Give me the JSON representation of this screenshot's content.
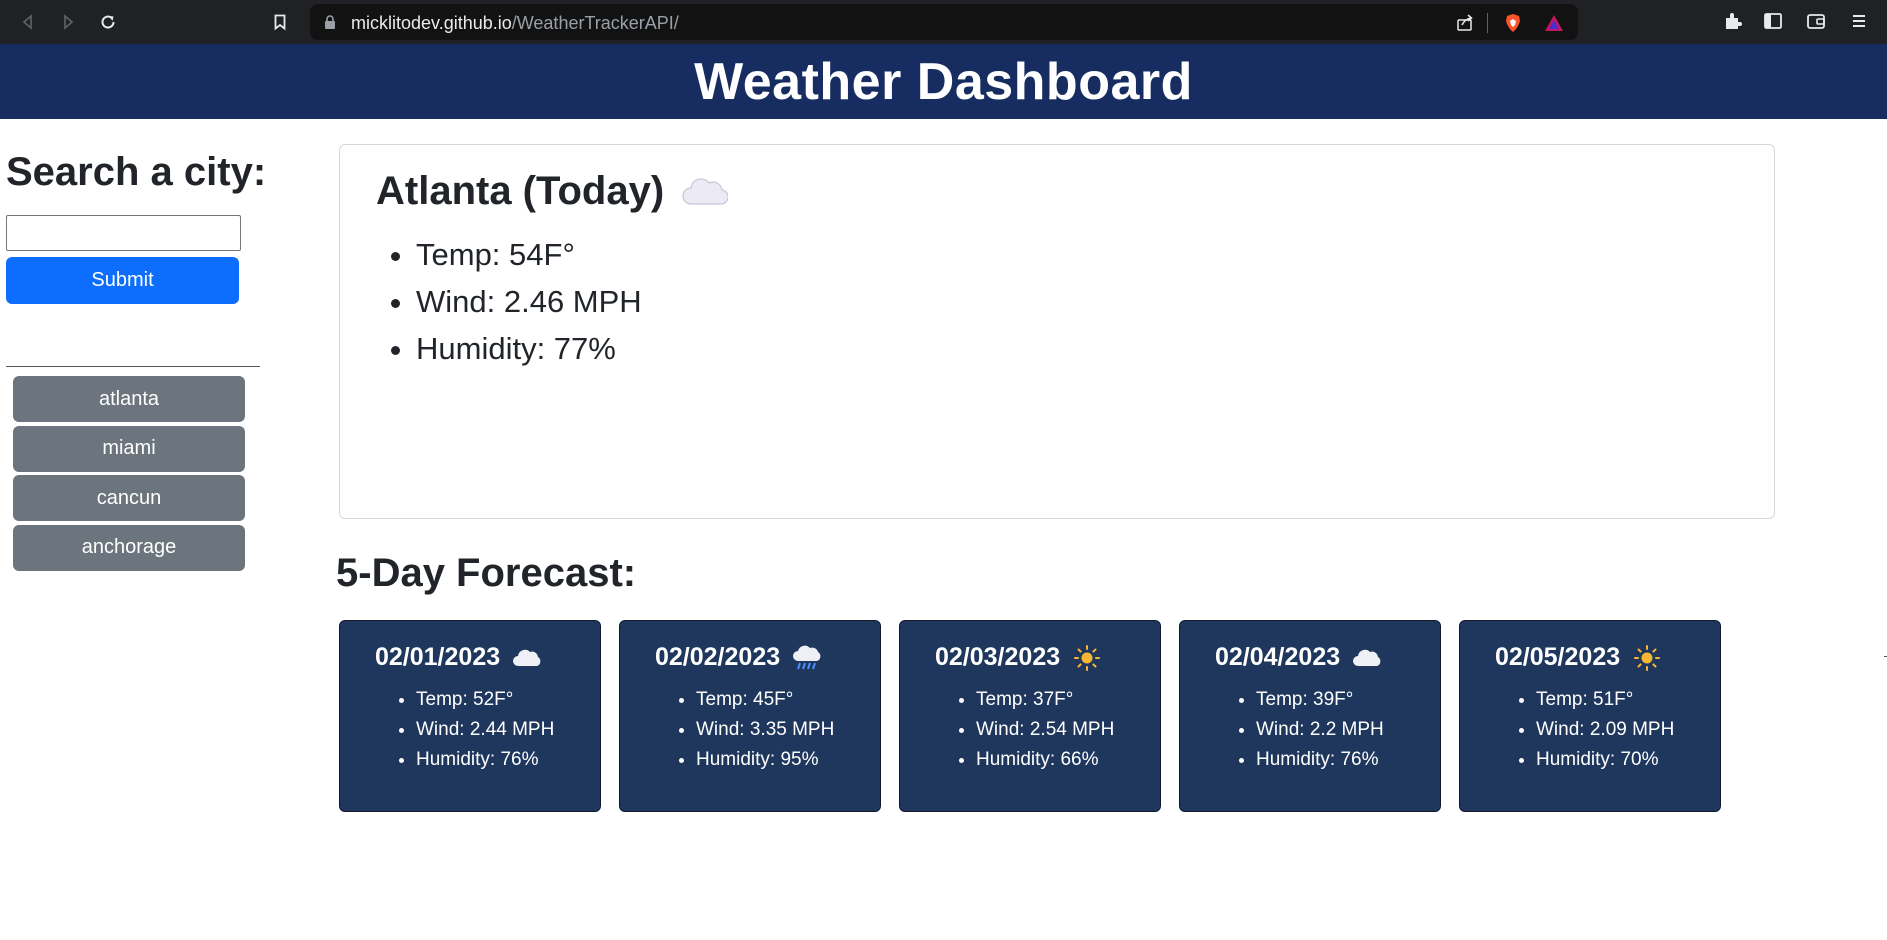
{
  "browser": {
    "url_host": "micklitodev.github.io",
    "url_path": "/WeatherTrackerAPI/"
  },
  "header": {
    "title": "Weather Dashboard"
  },
  "search": {
    "heading": "Search a city:",
    "input_value": "",
    "submit_label": "Submit"
  },
  "history": [
    "atlanta",
    "miami",
    "cancun",
    "anchorage"
  ],
  "today": {
    "title": "Atlanta (Today)",
    "icon": "cloud-icon",
    "temp": "Temp: 54F°",
    "wind": "Wind: 2.46 MPH",
    "humidity": "Humidity: 77%"
  },
  "forecast": {
    "heading": "5-Day Forecast:",
    "days": [
      {
        "date": "02/01/2023",
        "icon": "cloud-icon",
        "temp": "Temp: 52F°",
        "wind": "Wind: 2.44 MPH",
        "humidity": "Humidity: 76%"
      },
      {
        "date": "02/02/2023",
        "icon": "rain-cloud-icon",
        "temp": "Temp: 45F°",
        "wind": "Wind: 3.35 MPH",
        "humidity": "Humidity: 95%"
      },
      {
        "date": "02/03/2023",
        "icon": "sun-icon",
        "temp": "Temp: 37F°",
        "wind": "Wind: 2.54 MPH",
        "humidity": "Humidity: 66%"
      },
      {
        "date": "02/04/2023",
        "icon": "cloud-icon",
        "temp": "Temp: 39F°",
        "wind": "Wind: 2.2 MPH",
        "humidity": "Humidity: 76%"
      },
      {
        "date": "02/05/2023",
        "icon": "sun-icon",
        "temp": "Temp: 51F°",
        "wind": "Wind: 2.09 MPH",
        "humidity": "Humidity: 70%"
      }
    ]
  },
  "colors": {
    "header_bg": "#172d61",
    "card_bg": "#1f375d",
    "primary_button": "#0d6efd",
    "history_button": "#6c757d"
  }
}
